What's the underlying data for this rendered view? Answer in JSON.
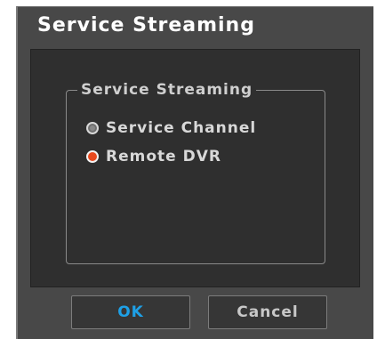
{
  "dialog": {
    "title": "Service Streaming"
  },
  "group": {
    "legend": "Service Streaming",
    "options": [
      {
        "label": "Service Channel",
        "selected": false
      },
      {
        "label": "Remote DVR",
        "selected": true
      }
    ]
  },
  "buttons": {
    "ok_label": "OK",
    "cancel_label": "Cancel"
  },
  "colors": {
    "accent_selected": "#e8491e",
    "ok_text": "#1ea0e6"
  }
}
